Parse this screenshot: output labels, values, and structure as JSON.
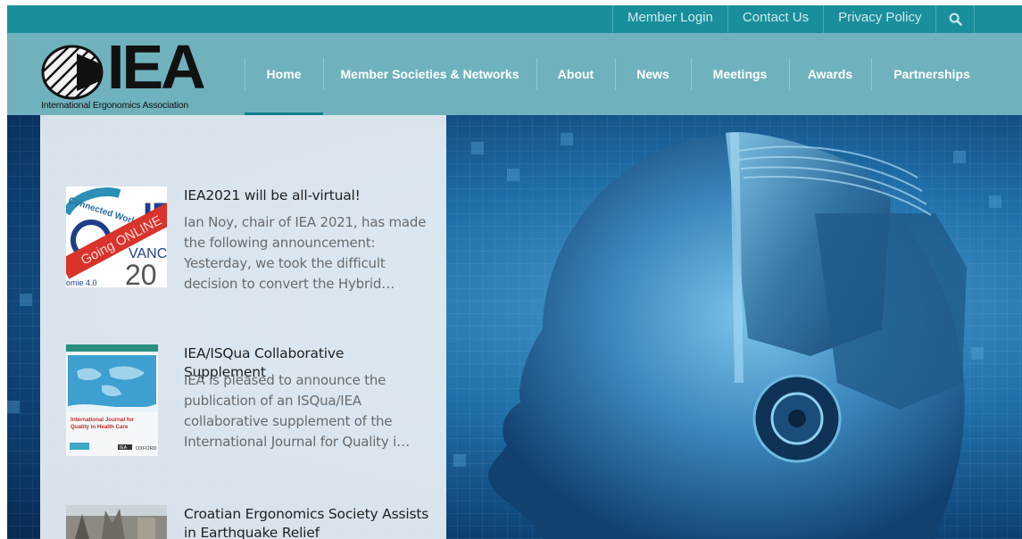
{
  "topbar": {
    "links": [
      "Member Login",
      "Contact Us",
      "Privacy Policy"
    ],
    "search_icon": "search-icon"
  },
  "logo": {
    "wordmark": "IEA",
    "tagline": "International Ergonomics Association"
  },
  "nav": {
    "items": [
      "Home",
      "Member Societies & Networks",
      "About",
      "News",
      "Meetings",
      "Awards",
      "Partnerships"
    ],
    "active": "Home"
  },
  "news": [
    {
      "title": "IEA2021 will be all-virtual!",
      "excerpt": "Ian Noy, chair of IEA 2021, has made the following announcement: Yesterday, we took the difficult decision to convert the Hybrid…",
      "thumb": {
        "banner": "Going ONLINE",
        "arc_text": "Connected World",
        "word_fragment": "VANCO",
        "year_fragment": "20",
        "corner_fragment": "omie 4.0"
      }
    },
    {
      "title": "IEA/ISQua Collaborative Supplement",
      "excerpt": "IEA is pleased to announce the publication of an ISQua/IEA collaborative supplement of the International Journal for Quality i…",
      "thumb": {
        "journal_title": "International Journal for Quality in Health Care",
        "logo_a": "IEA",
        "logo_b": "OXFORD"
      }
    },
    {
      "title": "Croatian Ergonomics Society Assists in Earthquake Relief",
      "excerpt": ""
    }
  ],
  "colors": {
    "topbar": "#1a8f9c",
    "header": "#6fb2bd",
    "nav_active_underline": "#13808c",
    "panel": "#e9f0f5",
    "banner_red": "#d9332b"
  }
}
